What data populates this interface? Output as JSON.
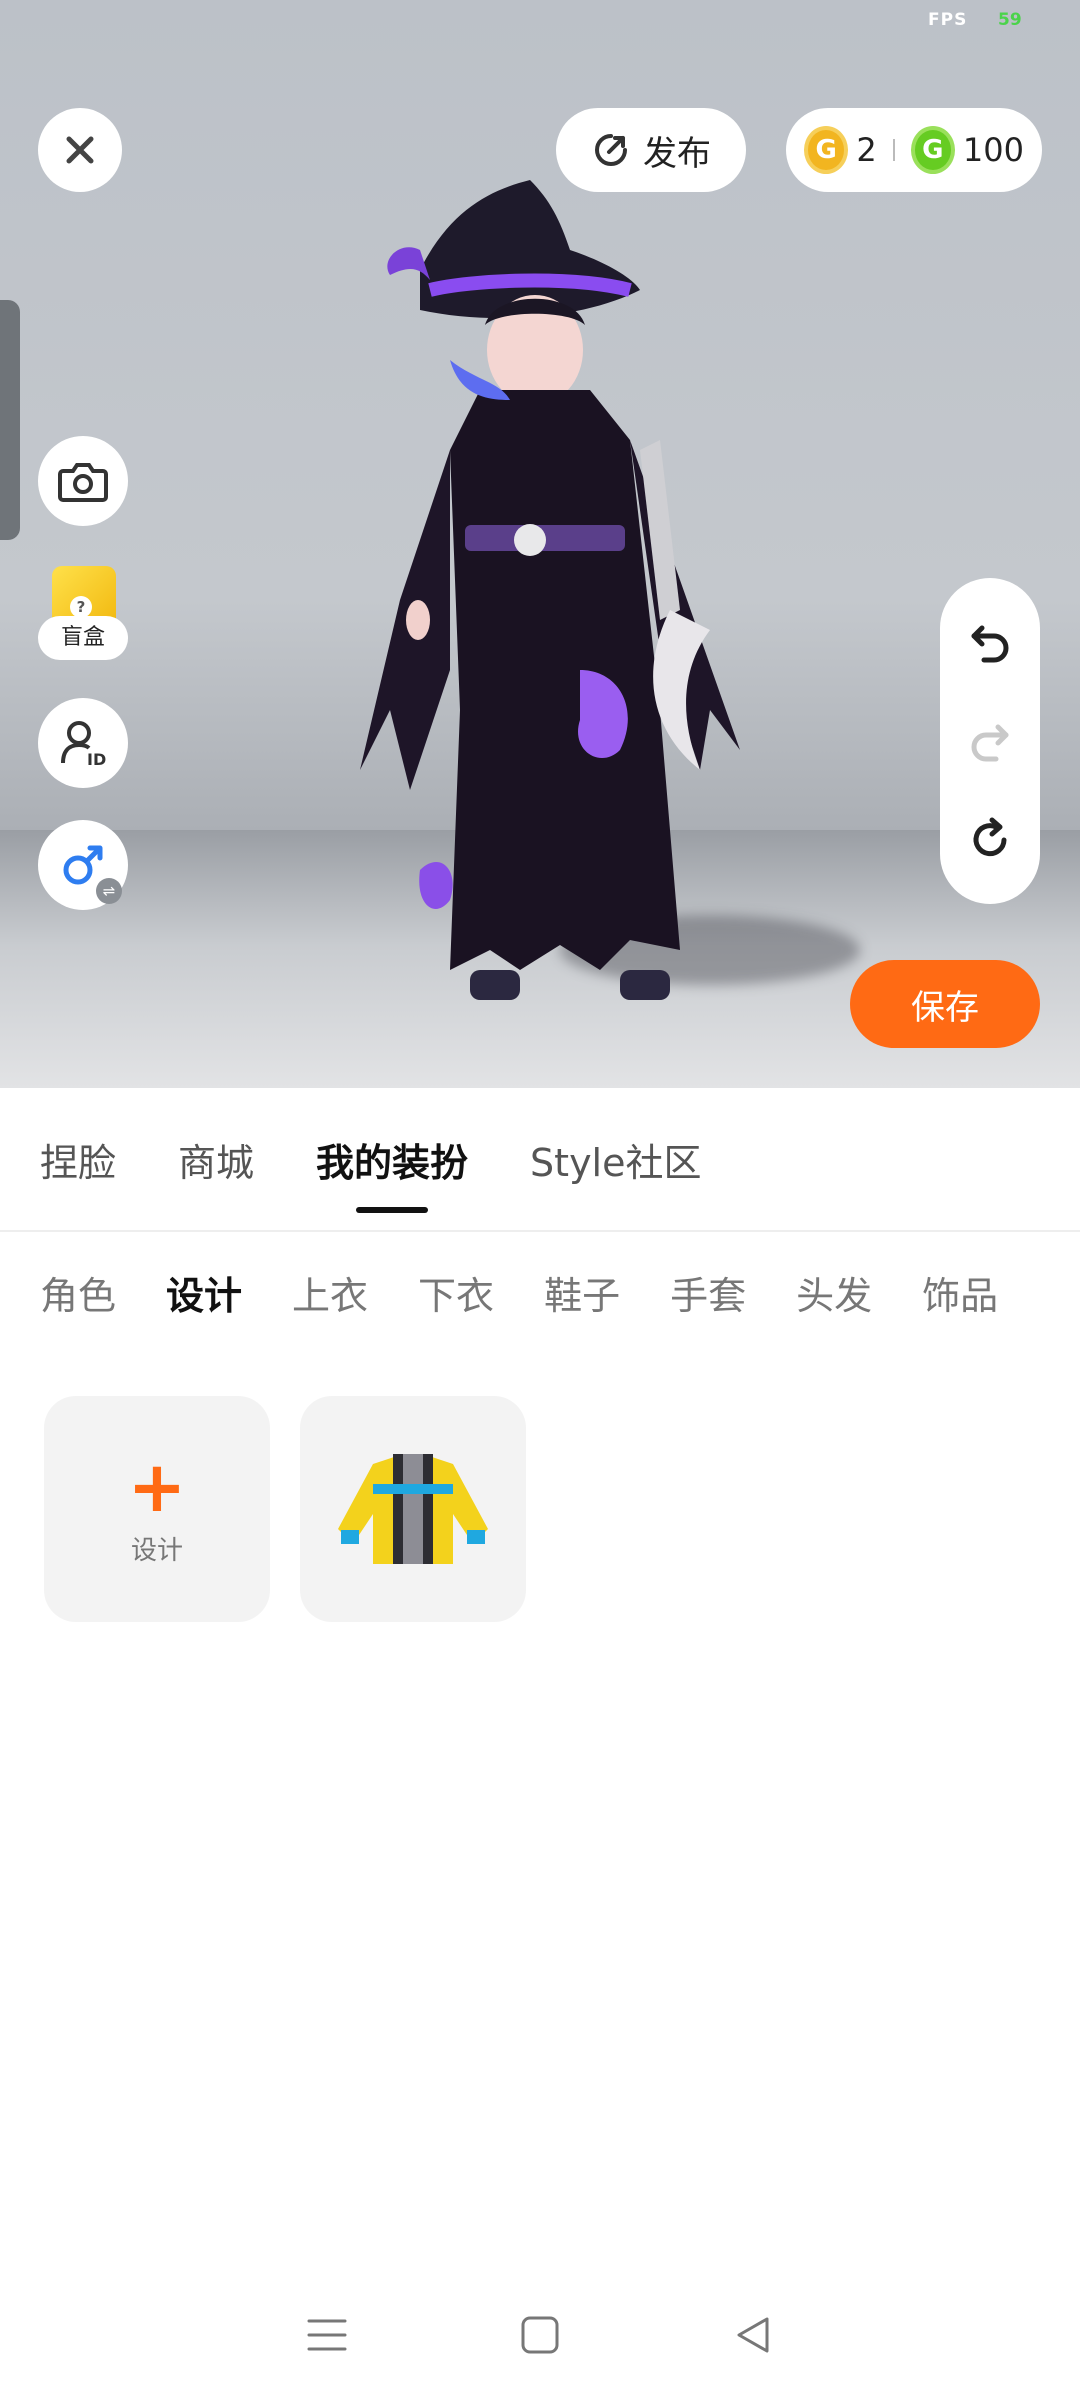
{
  "status": {
    "fps_label": "FPS",
    "fps_value": "59"
  },
  "toolbar": {
    "publish_label": "发布",
    "currency": {
      "gold_amount": "2",
      "green_amount": "100"
    }
  },
  "side": {
    "blindbox_label": "盲盒"
  },
  "actions": {
    "save_label": "保存"
  },
  "main_tabs": [
    "捏脸",
    "商城",
    "我的装扮",
    "Style社区"
  ],
  "main_tab_active": "我的装扮",
  "sub_tabs": [
    "角色",
    "设计",
    "上衣",
    "下衣",
    "鞋子",
    "手套",
    "头发",
    "饰品"
  ],
  "sub_tab_active": "设计",
  "grid": {
    "design_label": "设计"
  },
  "colors": {
    "accent": "#ff6a14",
    "gold": "#f2b520",
    "green": "#66cc22"
  },
  "icons": [
    "close-icon",
    "publish-icon",
    "camera-icon",
    "id-card-icon",
    "gender-switch-icon",
    "undo-icon",
    "redo-icon",
    "reset-icon",
    "menu-icon",
    "home-icon",
    "back-icon"
  ]
}
